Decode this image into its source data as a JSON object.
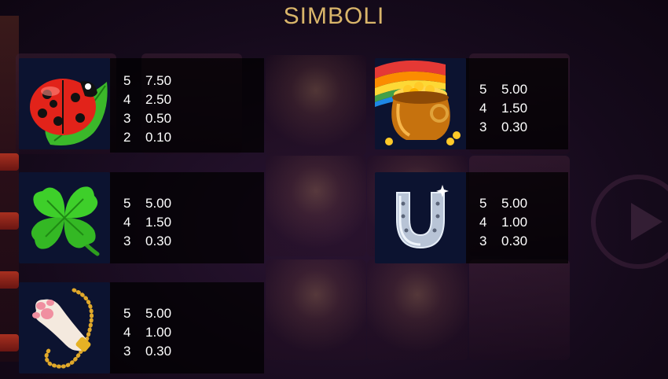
{
  "title": "SIMBOLI",
  "symbols": [
    {
      "name": "ladybug",
      "icon": "ladybug-icon",
      "payouts": [
        {
          "count": "5",
          "value": "7.50"
        },
        {
          "count": "4",
          "value": "2.50"
        },
        {
          "count": "3",
          "value": "0.50"
        },
        {
          "count": "2",
          "value": "0.10"
        }
      ]
    },
    {
      "name": "pot-of-gold",
      "icon": "pot-of-gold-icon",
      "payouts": [
        {
          "count": "5",
          "value": "5.00"
        },
        {
          "count": "4",
          "value": "1.50"
        },
        {
          "count": "3",
          "value": "0.30"
        }
      ]
    },
    {
      "name": "clover",
      "icon": "four-leaf-clover-icon",
      "payouts": [
        {
          "count": "5",
          "value": "5.00"
        },
        {
          "count": "4",
          "value": "1.50"
        },
        {
          "count": "3",
          "value": "0.30"
        }
      ]
    },
    {
      "name": "horseshoe",
      "icon": "horseshoe-icon",
      "payouts": [
        {
          "count": "5",
          "value": "5.00"
        },
        {
          "count": "4",
          "value": "1.00"
        },
        {
          "count": "3",
          "value": "0.30"
        }
      ]
    },
    {
      "name": "rabbit-foot",
      "icon": "rabbit-foot-icon",
      "payouts": [
        {
          "count": "5",
          "value": "5.00"
        },
        {
          "count": "4",
          "value": "1.00"
        },
        {
          "count": "3",
          "value": "0.30"
        }
      ]
    }
  ],
  "colors": {
    "title": "#d9b56a",
    "icon_background": "#0c1330",
    "text": "#ffffff"
  }
}
